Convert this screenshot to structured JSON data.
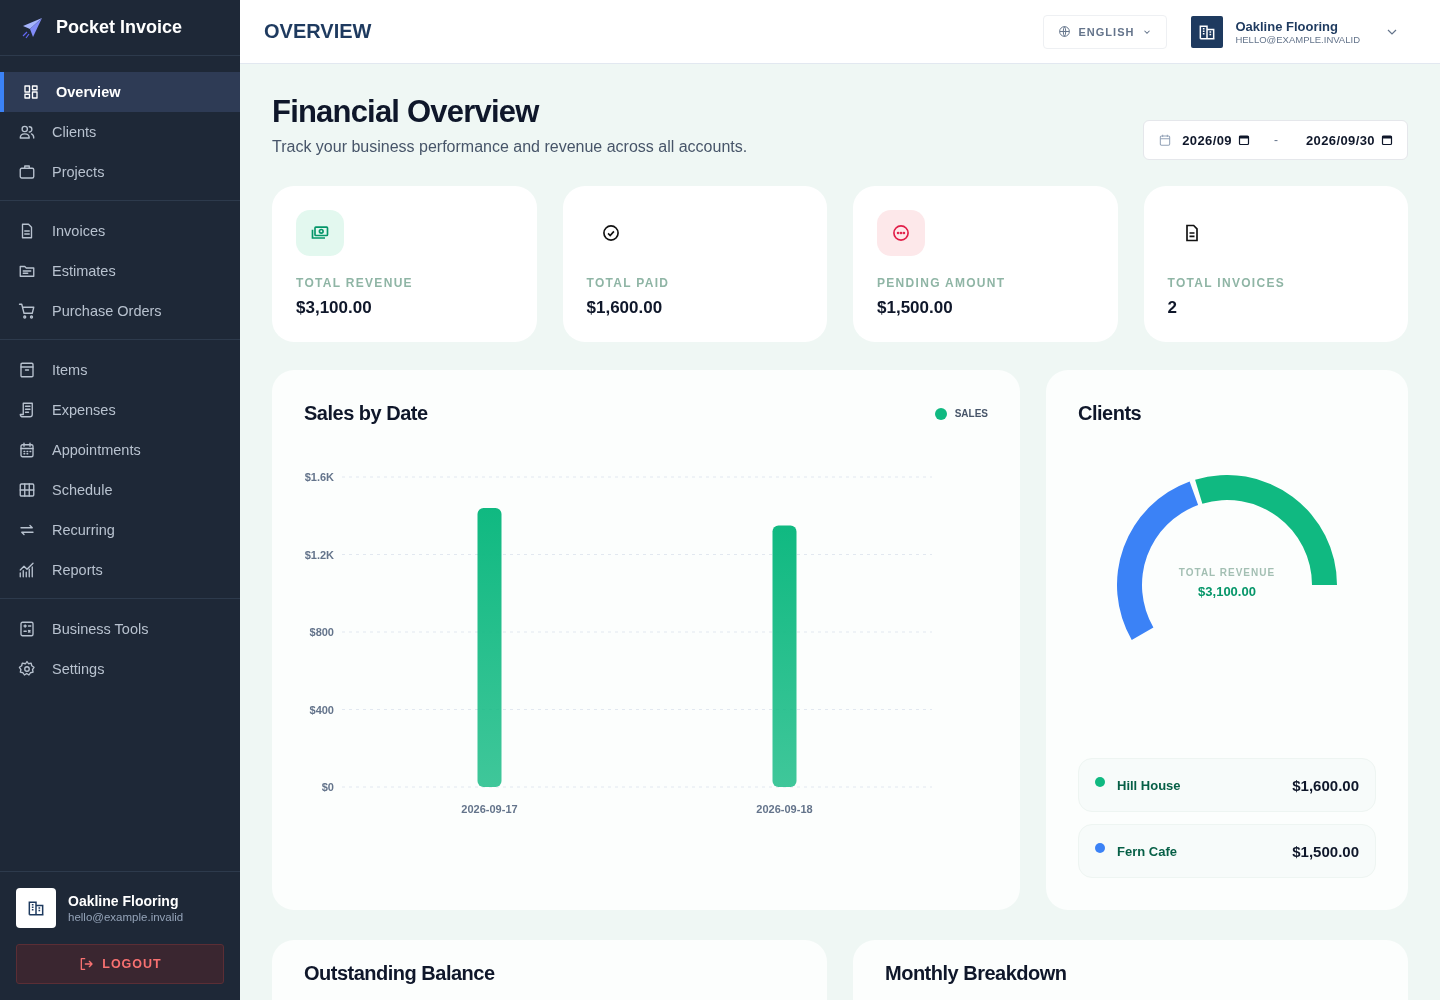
{
  "brand": {
    "name": "Pocket Invoice"
  },
  "sidebar": {
    "sections": [
      {
        "items": [
          {
            "label": "Overview",
            "selected": true
          },
          {
            "label": "Clients",
            "selected": false
          },
          {
            "label": "Projects",
            "selected": false
          }
        ]
      },
      {
        "items": [
          {
            "label": "Invoices",
            "selected": false
          },
          {
            "label": "Estimates",
            "selected": false
          },
          {
            "label": "Purchase Orders",
            "selected": false
          }
        ]
      },
      {
        "items": [
          {
            "label": "Items",
            "selected": false
          },
          {
            "label": "Expenses",
            "selected": false
          },
          {
            "label": "Appointments",
            "selected": false
          },
          {
            "label": "Schedule",
            "selected": false
          },
          {
            "label": "Recurring",
            "selected": false
          },
          {
            "label": "Reports",
            "selected": false
          }
        ]
      },
      {
        "items": [
          {
            "label": "Business Tools",
            "selected": false
          },
          {
            "label": "Settings",
            "selected": false
          }
        ]
      }
    ],
    "account": {
      "name": "Oakline Flooring",
      "email": "hello@example.invalid"
    },
    "logout": "LOGOUT"
  },
  "header": {
    "title": "OVERVIEW",
    "language": "ENGLISH",
    "account": {
      "name": "Oakline Flooring",
      "email": "HELLO@EXAMPLE.INVALID"
    }
  },
  "page": {
    "title": "Financial Overview",
    "subtitle": "Track your business performance and revenue across all accounts.",
    "date_range": {
      "start": "2026/09",
      "separator": "-",
      "end": "2026/09/30"
    }
  },
  "stats": [
    {
      "kind": "revenue",
      "label": "TOTAL REVENUE",
      "value": "$3,100.00"
    },
    {
      "kind": "paid",
      "label": "TOTAL PAID",
      "value": "$1,600.00"
    },
    {
      "kind": "pending",
      "label": "PENDING AMOUNT",
      "value": "$1,500.00"
    },
    {
      "kind": "invoices",
      "label": "TOTAL INVOICES",
      "value": "2"
    }
  ],
  "sales_card": {
    "title": "Sales by Date",
    "chart_data": {
      "type": "bar",
      "categories": [
        "2026-09-17",
        "2026-09-18"
      ],
      "series": [
        {
          "name": "SALES",
          "color": "#10b981",
          "values": [
            1440,
            1350
          ]
        }
      ],
      "ylim": [
        0,
        1600
      ],
      "grid": true,
      "yticks": [
        {
          "value": 0,
          "label": "$0"
        },
        {
          "value": 400,
          "label": "$400"
        },
        {
          "value": 800,
          "label": "$800"
        },
        {
          "value": 1200,
          "label": "$1.2K"
        },
        {
          "value": 1600,
          "label": "$1.6K"
        }
      ]
    }
  },
  "clients_card": {
    "title": "Clients",
    "center_label": "TOTAL REVENUE",
    "center_value": "$3,100.00",
    "chart_data": {
      "type": "donut",
      "categories": [
        "Hill House",
        "Fern Cafe"
      ],
      "values": [
        51.6,
        48.4
      ],
      "colors": [
        "#10b981",
        "#3b82f6"
      ],
      "legend": "bottom"
    },
    "clients": [
      {
        "amount": "$1,600.00"
      },
      {
        "amount": "$1,500.00"
      }
    ]
  },
  "bottom_cards": [
    {
      "title": "Outstanding Balance"
    },
    {
      "title": "Monthly Breakdown"
    }
  ]
}
